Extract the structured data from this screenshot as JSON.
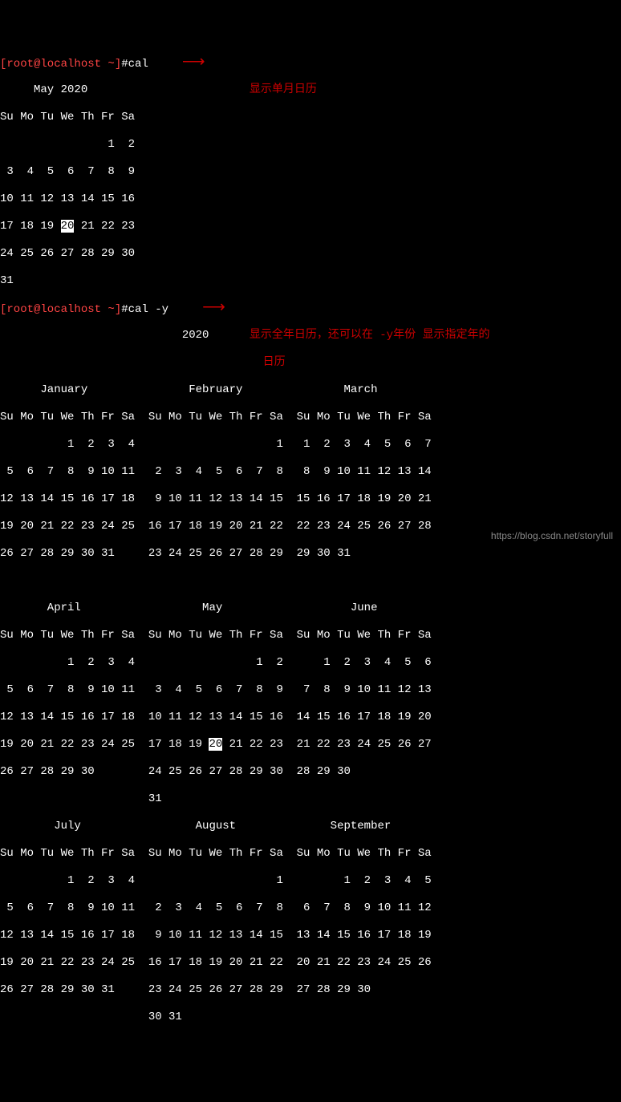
{
  "prompt1": {
    "user": "[root@localhost ~]",
    "symbol": "#",
    "command": "cal"
  },
  "annotation1": "显示单月日历",
  "month_cal": {
    "title": "     May 2020",
    "header": "Su Mo Tu We Th Fr Sa",
    "rows": [
      "                1  2",
      " 3  4  5  6  7  8  9",
      "10 11 12 13 14 15 16"
    ],
    "row_highlight": {
      "pre": "17 18 19 ",
      "day": "20",
      "post": " 21 22 23"
    },
    "rows_after": [
      "24 25 26 27 28 29 30",
      "31"
    ]
  },
  "prompt2": {
    "user": "[root@localhost ~]",
    "symbol": "#",
    "command": "cal -y"
  },
  "annotation2a": "显示全年日历，还可以在 -y年份 显示指定年的",
  "annotation2b": "日历",
  "year_title": "                           2020",
  "year_cal": {
    "row1_titles": "      January               February               March",
    "row1_headers": "Su Mo Tu We Th Fr Sa  Su Mo Tu We Th Fr Sa  Su Mo Tu We Th Fr Sa",
    "row1": [
      "          1  2  3  4                     1   1  2  3  4  5  6  7",
      " 5  6  7  8  9 10 11   2  3  4  5  6  7  8   8  9 10 11 12 13 14",
      "12 13 14 15 16 17 18   9 10 11 12 13 14 15  15 16 17 18 19 20 21",
      "19 20 21 22 23 24 25  16 17 18 19 20 21 22  22 23 24 25 26 27 28",
      "26 27 28 29 30 31     23 24 25 26 27 28 29  29 30 31",
      ""
    ],
    "row2_titles": "       April                  May                   June",
    "row2_headers": "Su Mo Tu We Th Fr Sa  Su Mo Tu We Th Fr Sa  Su Mo Tu We Th Fr Sa",
    "row2": [
      "          1  2  3  4                  1  2      1  2  3  4  5  6",
      " 5  6  7  8  9 10 11   3  4  5  6  7  8  9   7  8  9 10 11 12 13",
      "12 13 14 15 16 17 18  10 11 12 13 14 15 16  14 15 16 17 18 19 20"
    ],
    "row2_highlight": {
      "pre": "19 20 21 22 23 24 25  17 18 19 ",
      "day": "20",
      "post": " 21 22 23  21 22 23 24 25 26 27"
    },
    "row2_after": [
      "26 27 28 29 30        24 25 26 27 28 29 30  28 29 30",
      "                      31"
    ],
    "row3_titles": "        July                 August              September",
    "row3_headers": "Su Mo Tu We Th Fr Sa  Su Mo Tu We Th Fr Sa  Su Mo Tu We Th Fr Sa",
    "row3": [
      "          1  2  3  4                     1         1  2  3  4  5",
      " 5  6  7  8  9 10 11   2  3  4  5  6  7  8   6  7  8  9 10 11 12",
      "12 13 14 15 16 17 18   9 10 11 12 13 14 15  13 14 15 16 17 18 19",
      "19 20 21 22 23 24 25  16 17 18 19 20 21 22  20 21 22 23 24 25 26",
      "26 27 28 29 30 31     23 24 25 26 27 28 29  27 28 29 30",
      "                      30 31"
    ]
  },
  "watermark": "https://blog.csdn.net/storyfull",
  "chart_data": {
    "type": "table",
    "title": "Linux cal command output",
    "current_date": "2020-05-20",
    "commands": [
      "cal",
      "cal -y"
    ],
    "year": 2020,
    "single_month": {
      "month": "May",
      "year": 2020,
      "highlighted_day": 20,
      "weekday_header": [
        "Su",
        "Mo",
        "Tu",
        "We",
        "Th",
        "Fr",
        "Sa"
      ]
    },
    "months_shown_in_year_view": [
      "January",
      "February",
      "March",
      "April",
      "May",
      "June",
      "July",
      "August",
      "September"
    ]
  }
}
